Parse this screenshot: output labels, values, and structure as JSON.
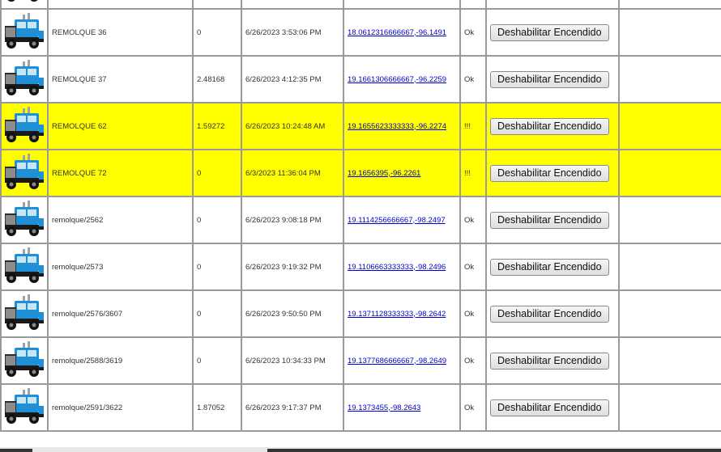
{
  "actions": {
    "disable_label": "Deshabilitar Encendido"
  },
  "icons": {
    "truck": "truck-icon"
  },
  "colors": {
    "warning_row": "#ffff00",
    "link": "#0000cc",
    "truck_body": "#1f8fd6"
  },
  "rows": [
    {
      "name": "",
      "value": "",
      "datetime": "",
      "coords": "",
      "status": "",
      "warn": false
    },
    {
      "name": "REMOLQUE 36",
      "value": "0",
      "datetime": "6/26/2023 3:53:06 PM",
      "coords": "18.0612316666667,-96.1491",
      "status": "Ok",
      "warn": false
    },
    {
      "name": "REMOLQUE 37",
      "value": "2.48168",
      "datetime": "6/26/2023 4:12:35 PM",
      "coords": "19.1661306666667,-96.2259",
      "status": "Ok",
      "warn": false
    },
    {
      "name": "REMOLQUE 62",
      "value": "1.59272",
      "datetime": "6/26/2023 10:24:48 AM",
      "coords": "19.1655623333333,-96.2274",
      "status": "!!!",
      "warn": true
    },
    {
      "name": "REMOLQUE 72",
      "value": "0",
      "datetime": "6/3/2023 11:36:04 PM",
      "coords": "19.1656395,-96.2261",
      "status": "!!!",
      "warn": true
    },
    {
      "name": "remolque/2562",
      "value": "0",
      "datetime": "6/26/2023 9:08:18 PM",
      "coords": "19.1114256666667,-98.2497",
      "status": "Ok",
      "warn": false
    },
    {
      "name": "remolque/2573",
      "value": "0",
      "datetime": "6/26/2023 9:19:32 PM",
      "coords": "19.1106663333333,-98.2496",
      "status": "Ok",
      "warn": false
    },
    {
      "name": "remolque/2576/3607",
      "value": "0",
      "datetime": "6/26/2023 9:50:50 PM",
      "coords": "19.1371128333333,-98.2642",
      "status": "Ok",
      "warn": false
    },
    {
      "name": "remolque/2588/3619",
      "value": "0",
      "datetime": "6/26/2023 10:34:33 PM",
      "coords": "19.1377686666667,-98.2649",
      "status": "Ok",
      "warn": false
    },
    {
      "name": "remolque/2591/3622",
      "value": "1.87052",
      "datetime": "6/26/2023 9:17:37 PM",
      "coords": "19.1373455,-98.2643",
      "status": "Ok",
      "warn": false
    }
  ]
}
